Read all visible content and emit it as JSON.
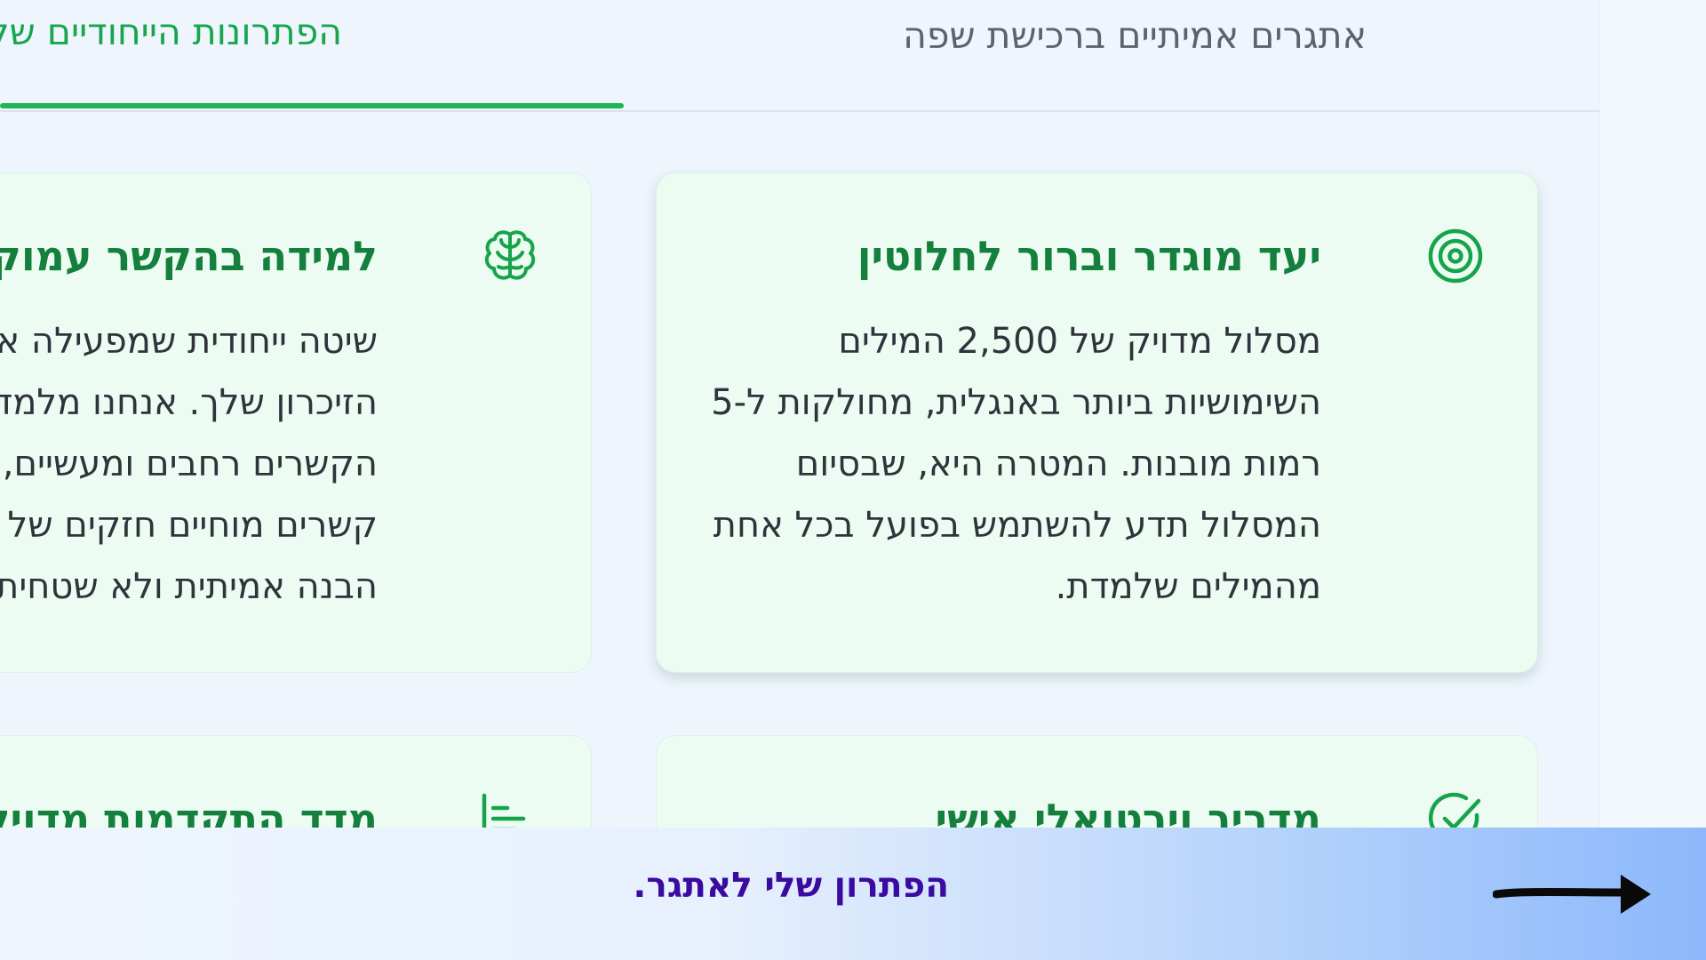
{
  "tabs": {
    "challenges_label": "אתגרים אמיתיים ברכישת שפה",
    "solutions_label": "הפתרונות הייחודיים שלנו"
  },
  "cards": {
    "goal": {
      "icon": "target-icon",
      "title": "יעד מוגדר וברור לחלוטין",
      "body": "מסלול מדויק של 2,500 המילים השימושיות ביותר באנגלית, מחולקות ל-5 רמות מובנות. המטרה היא, שבסיום המסלול תדע להשתמש בפועל בכל אחת מהמילים שלמדת."
    },
    "brain": {
      "icon": "brain-icon",
      "title": "למידה בהקשר עמוק",
      "body_lines": [
        "שיטה ייחודית שמפעילה את",
        "הזיכרון שלך. אנחנו מלמדים",
        "הקשרים רחבים ומעשיים,",
        "קשרים מוחיים חזקים של",
        "הבנה אמיתית ולא שטחית."
      ]
    },
    "coach": {
      "icon": "check-circle-icon",
      "title": "מדריך וירטואלי אישי"
    },
    "progress": {
      "icon": "progress-list-icon",
      "title": "מדד התקדמות מדויק"
    }
  },
  "cta": {
    "text": "הפתרון שלי לאתגר.",
    "arrow_icon": "arrow-right-icon"
  },
  "colors": {
    "accent_green": "#15803d",
    "tab_active_green": "#17a64d",
    "card_bg": "#ecfcf3",
    "cta_text": "#3b0aa0"
  }
}
